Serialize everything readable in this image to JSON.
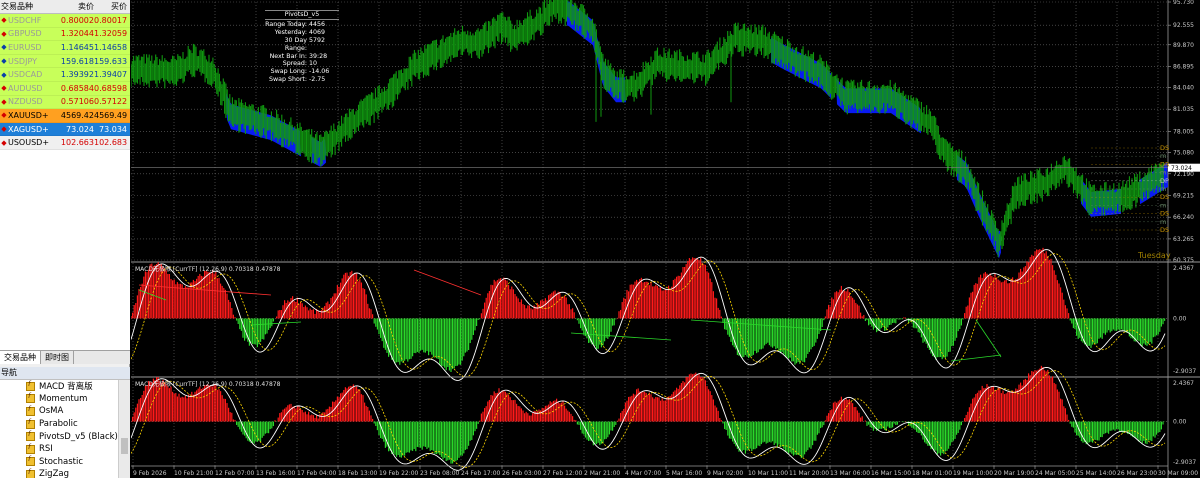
{
  "market_watch": {
    "header": {
      "symbol": "交易品种",
      "bid": "卖价",
      "ask": "买价"
    },
    "rows": [
      {
        "symbol": "USDCHF",
        "bid": "0.80002",
        "ask": "0.80017",
        "style": "green",
        "dir": "up",
        "value_color": "red"
      },
      {
        "symbol": "GBPUSD",
        "bid": "1.32044",
        "ask": "1.32059",
        "style": "green",
        "dir": "up",
        "value_color": "red"
      },
      {
        "symbol": "EURUSD",
        "bid": "1.14645",
        "ask": "1.14658",
        "style": "green",
        "dir": "dn",
        "value_color": "blue"
      },
      {
        "symbol": "USDJPY",
        "bid": "159.618",
        "ask": "159.633",
        "style": "green",
        "dir": "dn",
        "value_color": "blue"
      },
      {
        "symbol": "USDCAD",
        "bid": "1.39392",
        "ask": "1.39407",
        "style": "green",
        "dir": "dn",
        "value_color": "blue"
      },
      {
        "symbol": "AUDUSD",
        "bid": "0.68584",
        "ask": "0.68598",
        "style": "green",
        "dir": "up",
        "value_color": "red"
      },
      {
        "symbol": "NZDUSD",
        "bid": "0.57106",
        "ask": "0.57122",
        "style": "green",
        "dir": "up",
        "value_color": "red"
      },
      {
        "symbol": "XAUUSD+",
        "bid": "4569.42",
        "ask": "4569.49",
        "style": "orange",
        "dir": "up",
        "value_color": "black"
      },
      {
        "symbol": "XAGUSD+",
        "bid": "73.024",
        "ask": "73.034",
        "style": "blue",
        "dir": "up",
        "value_color": "white"
      },
      {
        "symbol": "USOUSD+",
        "bid": "102.663",
        "ask": "102.683",
        "style": "plain",
        "dir": "up",
        "value_color": "red"
      }
    ],
    "tabs": [
      {
        "label": "交易品种",
        "active": true
      },
      {
        "label": "即时图",
        "active": false
      }
    ]
  },
  "navigator": {
    "title": "导航",
    "items": [
      "MACD 背离版",
      "Momentum",
      "OsMA",
      "Parabolic",
      "PivotsD_v5 (Black)",
      "RSI",
      "Stochastic",
      "ZigZag"
    ]
  },
  "pivot_panel": {
    "title": "PivotsD_v5",
    "rows": [
      {
        "label": "Range  Today:",
        "value": "4456"
      },
      {
        "label": "Yesterday:",
        "value": "4069"
      },
      {
        "label": "30 Day Range:",
        "value": "5792"
      },
      {
        "label": "Next Bar In:",
        "value": "39:28"
      },
      {
        "label": "Spread:",
        "value": "10"
      },
      {
        "label": "Swap  Long:",
        "value": "-14.06"
      },
      {
        "label": "Swap  Short:",
        "value": "-2.75"
      }
    ]
  },
  "price_axis": {
    "labels": [
      "95.730",
      "92.555",
      "89.870",
      "86.895",
      "84.040",
      "81.035",
      "78.005",
      "75.080",
      "72.190",
      "69.215",
      "66.240",
      "63.265",
      "60.375"
    ],
    "current_price": "73.024"
  },
  "indicator_windows": [
    {
      "label": "MACD无极限 [CurrTF] (12,26,9) 0.70318 0.47878",
      "axis_top": "2.4367",
      "axis_mid": "0.00",
      "axis_bottom": "-2.9037"
    },
    {
      "label": "MACD无极限 [CurrTF] (12,26,9) 0.70318 0.47878",
      "axis_top": "2.4367",
      "axis_mid": "0.00",
      "axis_bottom": "-2.9037"
    }
  ],
  "time_axis": [
    "9 Feb 2026",
    "10 Feb 21:00",
    "12 Feb 07:00",
    "13 Feb 16:00",
    "17 Feb 04:00",
    "18 Feb 13:00",
    "19 Feb 22:00",
    "23 Feb 08:00",
    "24 Feb 17:00",
    "26 Feb 03:00",
    "27 Feb 12:00",
    "2 Mar 21:00",
    "4 Mar 07:00",
    "5 Mar 16:00",
    "9 Mar 02:00",
    "10 Mar 11:00",
    "11 Mar 20:00",
    "13 Mar 06:00",
    "16 Mar 15:00",
    "18 Mar 01:00",
    "19 Mar 10:00",
    "20 Mar 19:00",
    "24 Mar 05:00",
    "25 Mar 14:00",
    "26 Mar 23:00",
    "30 Mar 09:00"
  ],
  "chart_overlay": {
    "day_label": "Tuesday",
    "pivot_tags": [
      "DS",
      "m",
      "DR",
      "m",
      "DP",
      "m",
      "DS",
      "m",
      "DS",
      "m",
      "DS"
    ]
  },
  "colors": {
    "bull_candle": "#109810",
    "bear_band": "#0a1cff",
    "grid": "#6a6a6a",
    "hist_up": "#ff1a1a",
    "hist_dn": "#2ad82a",
    "macd_line": "#ffffff",
    "signal_line": "#ffd800"
  }
}
